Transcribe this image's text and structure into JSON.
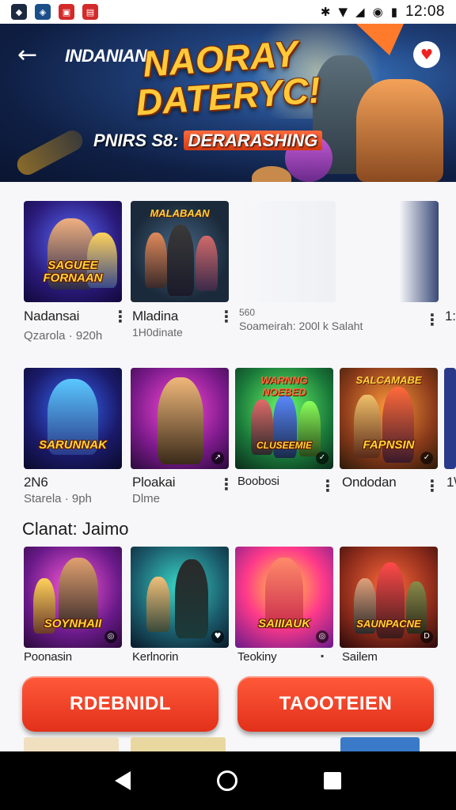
{
  "status_bar": {
    "time": "12:08",
    "icons": [
      "bluetooth-icon",
      "wifi-icon",
      "signal-icon",
      "data-saver-icon",
      "battery-icon"
    ]
  },
  "banner": {
    "brand": "INDANIAN",
    "title_line1": "NAORAY",
    "title_line2": "DATERYC!",
    "subtitle_prefix": "PNIRS S8:",
    "subtitle_highlight": "DERARASHING"
  },
  "rows": [
    {
      "tiles": [
        {
          "caption": "SAGUEE FORNAAN",
          "header": "",
          "title": "Nadansai",
          "sub": "Qzarola · 920h"
        },
        {
          "caption": "",
          "header": "MALABAAN",
          "title": "Mladina",
          "sub": "1H0dinate"
        },
        {
          "caption": "",
          "header": "",
          "title": "560",
          "sub": "Soameirah: 200l k Salaht"
        },
        {
          "caption": "",
          "header": "",
          "title": "",
          "sub": ""
        }
      ],
      "edge_label": "1:"
    },
    {
      "tiles": [
        {
          "caption": "SARUNNAK",
          "header": "",
          "title": "2N6",
          "sub": "Starela · 9ph"
        },
        {
          "caption": "",
          "header": "",
          "title": "Ploakai",
          "sub": "Dlme"
        },
        {
          "caption": "CLUSEEMIE",
          "header": "WARNNG NOEBED",
          "title": "Boobosi",
          "sub": ""
        },
        {
          "caption": "FAPNSIN",
          "header": "SALCAMABE",
          "title": "Ondodan",
          "sub": ""
        }
      ],
      "edge_label": "1\\"
    },
    {
      "section_title": "Clanat: Jaimo",
      "tiles": [
        {
          "caption": "SOYNHAII",
          "header": "",
          "title": "Poonasin",
          "sub": ""
        },
        {
          "caption": "",
          "header": "",
          "title": "Kerlnorin",
          "sub": ""
        },
        {
          "caption": "SAIIIAUK",
          "header": "",
          "title": "Teokiny",
          "sub": ""
        },
        {
          "caption": "SAUNPACNE",
          "header": "",
          "title": "Sailem",
          "sub": ""
        }
      ]
    }
  ],
  "actions": {
    "left_label": "RDEBNIDL",
    "right_label": "TAOOTEIEN"
  },
  "colors": {
    "accent": "#e2301a",
    "banner_bg": "#1f3f78",
    "title_gold": "#ffc93a"
  }
}
